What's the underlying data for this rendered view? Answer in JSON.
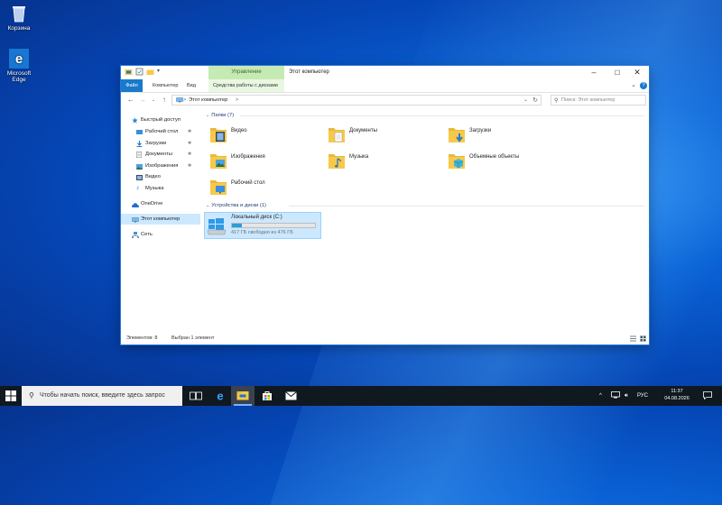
{
  "desktop": {
    "icons": [
      {
        "label": "Корзина"
      },
      {
        "label": "Microsoft Edge"
      }
    ]
  },
  "window": {
    "qat_extra": "▾",
    "context_tab": "Управление",
    "title": "Этот компьютер",
    "ribbon_tabs": [
      "Файл",
      "Компьютер",
      "Вид",
      "Средства работы с дисками"
    ],
    "address": {
      "path": "Этот компьютер",
      "separator": ">"
    },
    "search_placeholder": "Поиск: Этот компьютер",
    "sidebar": [
      {
        "label": "Быстрый доступ",
        "pinned": false
      },
      {
        "label": "Рабочий стол",
        "pinned": true
      },
      {
        "label": "Загрузки",
        "pinned": true
      },
      {
        "label": "Документы",
        "pinned": true
      },
      {
        "label": "Изображения",
        "pinned": true
      },
      {
        "label": "Видео",
        "pinned": false
      },
      {
        "label": "Музыка",
        "pinned": false
      },
      {
        "label": "OneDrive",
        "pinned": false
      },
      {
        "label": "Этот компьютер",
        "pinned": false
      },
      {
        "label": "Сеть",
        "pinned": false
      }
    ],
    "groups": {
      "folders_header": "Папки (7)",
      "devices_header": "Устройства и диски (1)"
    },
    "folders": [
      {
        "label": "Видео"
      },
      {
        "label": "Документы"
      },
      {
        "label": "Загрузки"
      },
      {
        "label": "Изображения"
      },
      {
        "label": "Музыка"
      },
      {
        "label": "Объемные объекты"
      },
      {
        "label": "Рабочий стол"
      }
    ],
    "drive": {
      "name": "Локальный диск (C:)",
      "space": "417 ГБ свободно из 476 ГБ",
      "used_fraction": 0.124
    },
    "status": {
      "items": "Элементов: 8",
      "selected": "Выбран 1 элемент"
    }
  },
  "taskbar": {
    "search_placeholder": "Чтобы начать поиск, введите здесь запрос",
    "lang": "РУС",
    "time": "11:37",
    "date": "04.08.2026"
  },
  "colors": {
    "accent": "#1979ca",
    "selection": "#cce8ff",
    "context_tab": "#c6eab4",
    "folder": "#f7c948"
  }
}
